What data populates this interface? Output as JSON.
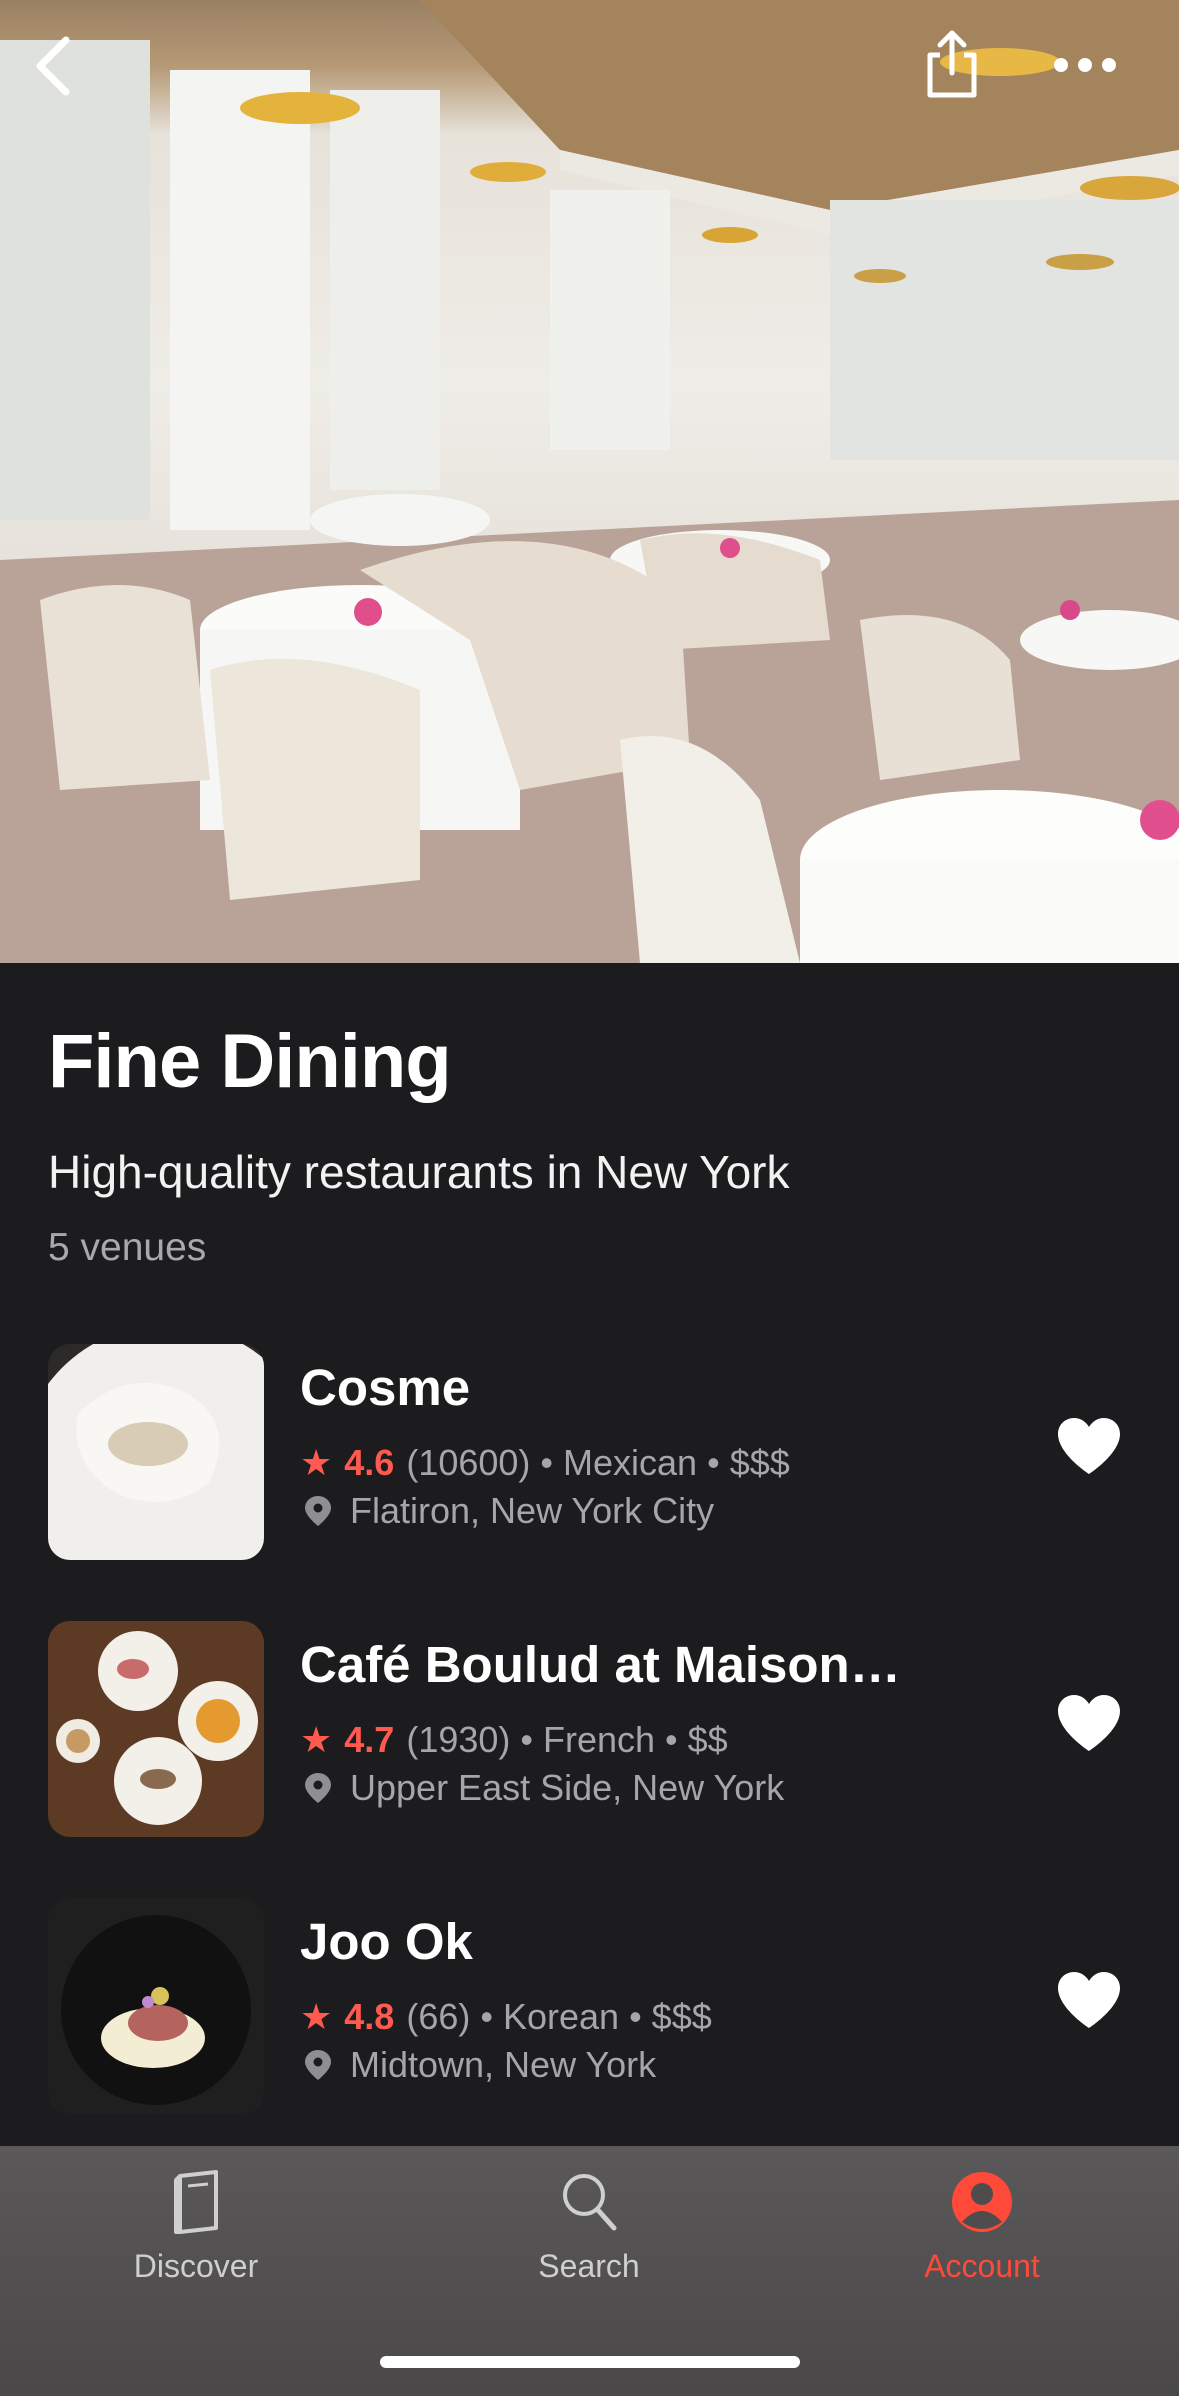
{
  "header": {
    "title": "Fine Dining",
    "subtitle": "High-quality restaurants in New York",
    "count": "5 venues"
  },
  "top_bar": {
    "back_icon": "chevron-left-icon",
    "share_icon": "share-icon",
    "more_icon": "more-horizontal-icon"
  },
  "venues": [
    {
      "name": "Cosme",
      "rating": "4.6",
      "reviews": "(10600)",
      "cuisine": "Mexican",
      "price": "$$$",
      "location": "Flatiron, New York City"
    },
    {
      "name": "Café Boulud at Maison…",
      "rating": "4.7",
      "reviews": "(1930)",
      "cuisine": "French",
      "price": "$$",
      "location": "Upper East Side, New York"
    },
    {
      "name": "Joo Ok",
      "rating": "4.8",
      "reviews": "(66)",
      "cuisine": "Korean",
      "price": "$$$",
      "location": "Midtown, New York"
    }
  ],
  "separator": "•",
  "tabs": [
    {
      "label": "Discover",
      "icon": "book-icon",
      "active": false
    },
    {
      "label": "Search",
      "icon": "search-icon",
      "active": false
    },
    {
      "label": "Account",
      "icon": "user-circle-icon",
      "active": true
    }
  ],
  "colors": {
    "accent": "#ff4a3a",
    "rating": "#ff5a4f",
    "background": "#1c1c1e"
  }
}
